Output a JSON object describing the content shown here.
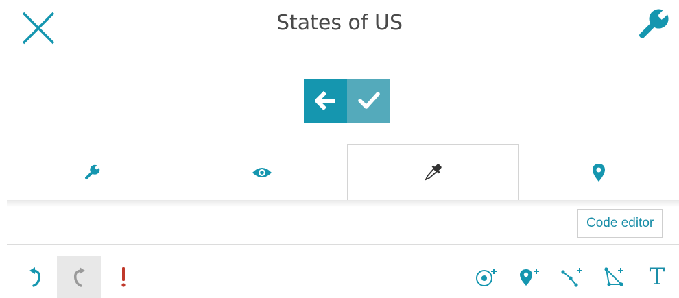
{
  "header": {
    "title": "States of US",
    "close_icon": "close-icon",
    "settings_icon": "wrench-icon"
  },
  "actions": {
    "back_icon": "arrow-left-icon",
    "confirm_icon": "check-icon"
  },
  "tabs": [
    {
      "icon": "wrench-icon",
      "active": false
    },
    {
      "icon": "eye-icon",
      "active": false
    },
    {
      "icon": "eyedropper-icon",
      "active": true
    },
    {
      "icon": "map-pin-icon",
      "active": false
    }
  ],
  "tooltip": {
    "text": "Code editor"
  },
  "toolbar": {
    "undo_icon": "undo-icon",
    "redo_icon": "redo-icon",
    "warning_icon": "exclamation-icon",
    "tools": [
      "add-point-icon",
      "add-marker-icon",
      "add-line-icon",
      "add-polygon-icon",
      "text-icon"
    ],
    "text_tool_label": "T"
  },
  "colors": {
    "accent": "#1596af",
    "accent_light": "#54aabb",
    "warning": "#c0392b",
    "title": "#4a4a4a",
    "disabled": "#9a9a9a"
  }
}
